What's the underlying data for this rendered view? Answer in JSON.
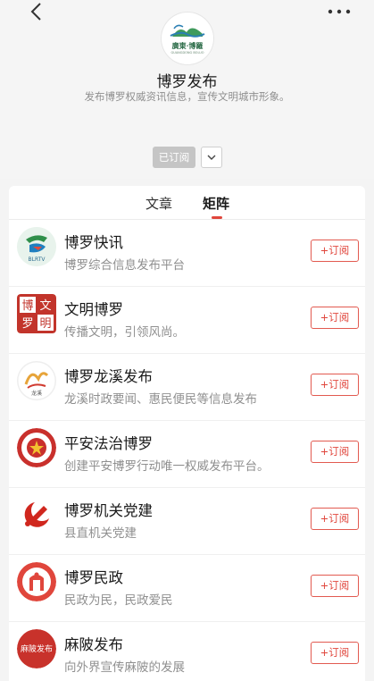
{
  "header": {
    "back_icon": "chevron-left-icon",
    "more_icon": "ellipsis-icon",
    "logo_text": "廣東·博羅",
    "logo_subtext": "GUANGDONG BOLUO",
    "title": "博罗发布",
    "description": "发布博罗权威资讯信息，宣传文明城市形象。",
    "subscribed_label": "已订阅",
    "dropdown_icon": "chevron-down-icon"
  },
  "tabs": [
    {
      "label": "文章",
      "active": false
    },
    {
      "label": "矩阵",
      "active": true
    }
  ],
  "accent_color": "#e0463c",
  "accounts": [
    {
      "name": "博罗快讯",
      "desc": "博罗综合信息发布平台",
      "button": "+订阅",
      "avatar_icon": "blrtv-logo-icon",
      "avatar_text": "BLRTV"
    },
    {
      "name": "文明博罗",
      "desc": "传播文明，引领风尚。",
      "button": "+订阅",
      "avatar_icon": "wenming-seal-icon",
      "avatar_text": "博罗文明"
    },
    {
      "name": "博罗龙溪发布",
      "desc": "龙溪时政要闻、惠民便民等信息发布",
      "button": "+订阅",
      "avatar_icon": "longxi-logo-icon",
      "avatar_text": "龙溪"
    },
    {
      "name": "平安法治博罗",
      "desc": "创建平安博罗行动唯一权威发布平台。",
      "button": "+订阅",
      "avatar_icon": "police-emblem-icon",
      "avatar_text": ""
    },
    {
      "name": "博罗机关党建",
      "desc": "县直机关党建",
      "button": "+订阅",
      "avatar_icon": "party-emblem-icon",
      "avatar_text": ""
    },
    {
      "name": "博罗民政",
      "desc": "民政为民，民政爱民",
      "button": "+订阅",
      "avatar_icon": "civil-affairs-logo-icon",
      "avatar_text": ""
    },
    {
      "name": "麻陂发布",
      "desc": "向外界宣传麻陂的发展",
      "button": "+订阅",
      "avatar_icon": "mabei-logo-icon",
      "avatar_text": "麻陂发布"
    }
  ]
}
